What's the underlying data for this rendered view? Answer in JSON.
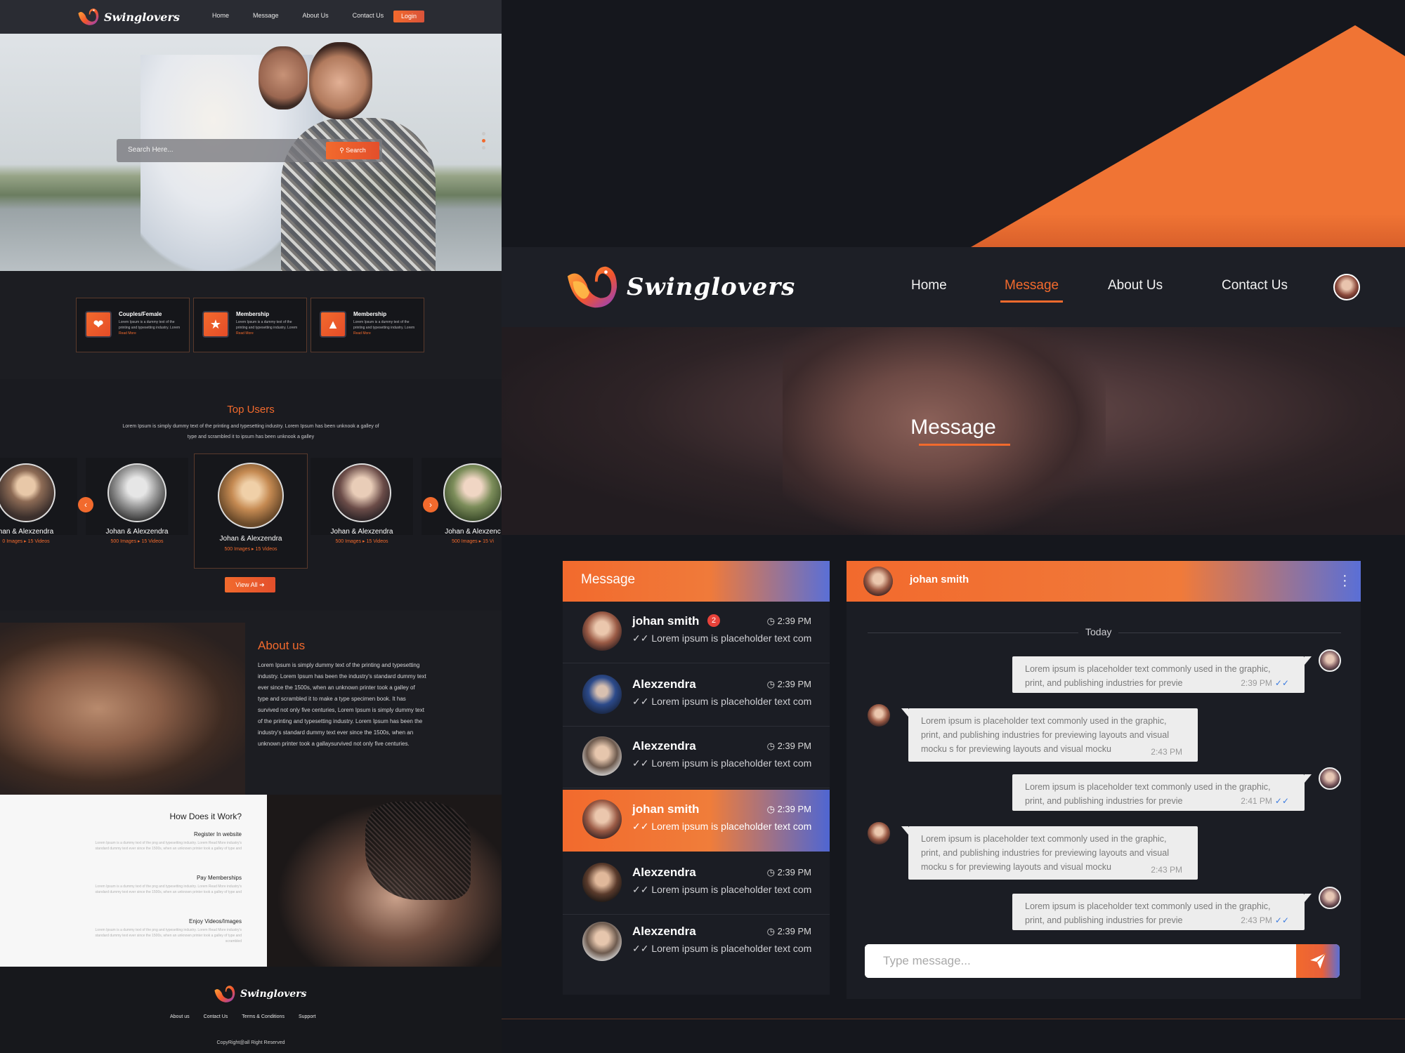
{
  "home": {
    "brand": "Swinglovers",
    "nav": [
      "Home",
      "Message",
      "About Us",
      "Contact Us"
    ],
    "login_label": "Login",
    "search": {
      "placeholder": "Search Here...",
      "button_label": "Search"
    },
    "features": [
      {
        "title": "Couples/Female",
        "body": "Lorem Ipsum is a dummy text of the printing and typesetting industry. Lorem",
        "more": "Read More",
        "icon": "couple-heart-icon"
      },
      {
        "title": "Membership",
        "body": "Lorem Ipsum is a dummy text of the printing and typesetting industry. Lorem",
        "more": "Read More",
        "icon": "star-icon"
      },
      {
        "title": "Membership",
        "body": "Lorem Ipsum is a dummy text of the printing and typesetting industry. Lorem",
        "more": "Read More",
        "icon": "photo-icon"
      }
    ],
    "top_users": {
      "title": "Top Users",
      "subtitle": "Lorem Ipsum is simply dummy text of the printing and typesetting industry. Lorem Ipsum has been unknook a galley of type and scrambled it to ipsum has been unknook a galley",
      "cards": [
        {
          "name": "han & Alexzendra",
          "stats": "0 Images   ▸ 15 Videos"
        },
        {
          "name": "Johan & Alexzendra",
          "stats": "500 Images   ▸ 15 Videos"
        },
        {
          "name": "Johan & Alexzendra",
          "stats": "500 Images   ▸ 15 Videos"
        },
        {
          "name": "Johan & Alexzendra",
          "stats": "500 Images   ▸ 15 Videos"
        },
        {
          "name": "Johan & Alexzenc",
          "stats": "500 Images   ▸ 15 Vi"
        }
      ],
      "view_all": "View All ➔"
    },
    "about": {
      "title": "About us",
      "body": "Lorem Ipsum is simply dummy text of the printing and typesetting industry. Lorem Ipsum has been the industry's standard dummy text ever since the 1500s, when an unknown printer took a galley of type and scrambled it to make a type specimen book. It has survived not only five centuries, Lorem Ipsum is simply dummy text of the printing and typesetting industry. Lorem Ipsum has been the industry's standard dummy text ever since the 1500s, when an unknown printer took a gallaysurvived not only five centuries."
    },
    "how": {
      "title": "How Does it Work?",
      "steps": [
        {
          "title": "Register In website",
          "body": "Lorem Ipsum is a dummy text of the png and typesetting industry. Lorem Read More industry's standard dummy text ever since the 1500s, when an unknown printer took a galley of type and"
        },
        {
          "title": "Pay Memberships",
          "body": "Lorem Ipsum is a dummy text of the png and typesetting industry. Lorem Read More industry's standard dummy text ever since the 1500s, when an unknown printer took a galley of type and"
        },
        {
          "title": "Enjoy Videos/Images",
          "body": "Lorem Ipsum is a dummy text of the png and typesetting industry. Lorem Read More industry's standard dummy text ever since the 1500s, when an unknown printer took a galley of type and scrambled"
        }
      ]
    },
    "footer": {
      "links": [
        "About us",
        "Contact Us",
        "Terms & Conditions",
        "Support"
      ],
      "copyright": "CopyRight@all Right Reserved"
    }
  },
  "message_page": {
    "brand": "Swinglovers",
    "nav": {
      "home": "Home",
      "message": "Message",
      "about": "About Us",
      "contact": "Contact Us"
    },
    "hero_title": "Message",
    "list_title": "Message",
    "conversations": [
      {
        "name": "johan smith",
        "badge": "2",
        "time": "◷ 2:39 PM",
        "preview": "✓✓ Lorem ipsum is placeholder text com"
      },
      {
        "name": "Alexzendra",
        "badge": "",
        "time": "◷ 2:39 PM",
        "preview": "✓✓ Lorem ipsum is placeholder text com"
      },
      {
        "name": "Alexzendra",
        "badge": "",
        "time": "◷ 2:39 PM",
        "preview": "✓✓ Lorem ipsum is placeholder text com"
      },
      {
        "name": "johan smith",
        "badge": "",
        "time": "◷ 2:39 PM",
        "preview": "✓✓ Lorem ipsum is placeholder text com"
      },
      {
        "name": "Alexzendra",
        "badge": "",
        "time": "◷ 2:39 PM",
        "preview": "✓✓ Lorem ipsum is placeholder text com"
      },
      {
        "name": "Alexzendra",
        "badge": "",
        "time": "◷ 2:39 PM",
        "preview": "✓✓ Lorem ipsum is placeholder text com"
      }
    ],
    "chat": {
      "contact_name": "johan smith",
      "day_label": "Today",
      "messages": [
        {
          "from": "me",
          "text": "Lorem ipsum is placeholder text commonly used in the graphic, print, and publishing industries for previe",
          "time": "2:39 PM"
        },
        {
          "from": "them",
          "text": "Lorem ipsum is placeholder text commonly used in the graphic, print, and publishing industries for previewing layouts and visual mocku s for previewing layouts and visual mocku",
          "time": "2:43 PM"
        },
        {
          "from": "me",
          "text": "Lorem ipsum is placeholder text commonly used in the graphic, print, and publishing industries for previe",
          "time": "2:41 PM"
        },
        {
          "from": "them",
          "text": "Lorem ipsum is placeholder text commonly used in the graphic, print, and publishing industries for previewing layouts and visual mocku s for previewing layouts and visual mocku",
          "time": "2:43 PM"
        },
        {
          "from": "me",
          "text": "Lorem ipsum is placeholder text commonly used in the graphic, print, and publishing industries for previe",
          "time": "2:43 PM"
        }
      ],
      "input_placeholder": "Type message..."
    }
  },
  "colors": {
    "accent": "#f26a2d",
    "accent_blue": "#5a6fd6",
    "bg_dark": "#14161d",
    "panel": "#1b1d24",
    "bubble": "#ededed"
  }
}
